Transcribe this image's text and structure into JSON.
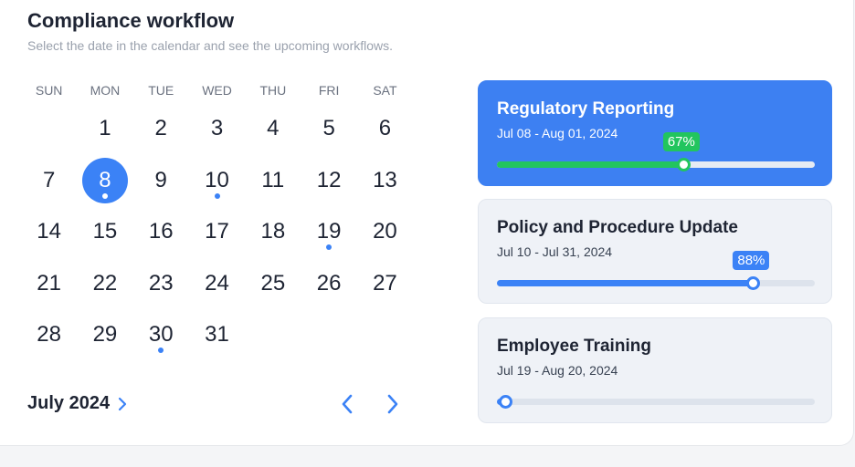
{
  "header": {
    "title": "Compliance workflow",
    "subtitle": "Select the date in the calendar and see the upcoming workflows."
  },
  "calendar": {
    "weekdays": [
      "SUN",
      "MON",
      "TUE",
      "WED",
      "THU",
      "FRI",
      "SAT"
    ],
    "weeks": [
      [
        null,
        1,
        2,
        3,
        4,
        5,
        6
      ],
      [
        7,
        8,
        9,
        10,
        11,
        12,
        13
      ],
      [
        14,
        15,
        16,
        17,
        18,
        19,
        20
      ],
      [
        21,
        22,
        23,
        24,
        25,
        26,
        27
      ],
      [
        28,
        29,
        30,
        31,
        null,
        null,
        null
      ]
    ],
    "selected_day": 8,
    "event_days": [
      8,
      10,
      19,
      30
    ],
    "month_label": "July 2024",
    "accent_color": "#3b82f6"
  },
  "workflows": [
    {
      "title": "Regulatory Reporting",
      "dates": "Jul 08 - Aug 01, 2024",
      "progress": 0.58,
      "badge": "67%",
      "active": true,
      "bar_color": "#22c55e",
      "badge_color": "#22c55e"
    },
    {
      "title": "Policy and Procedure Update",
      "dates": "Jul 10 - Jul 31, 2024",
      "progress": 0.8,
      "badge": "88%",
      "active": false,
      "bar_color": "#3b82f6",
      "badge_color": "#3b82f6"
    },
    {
      "title": "Employee Training",
      "dates": "Jul 19 - Aug 20, 2024",
      "progress": 0.02,
      "badge": "",
      "active": false,
      "bar_color": "#3b82f6",
      "badge_color": "#3b82f6"
    }
  ]
}
